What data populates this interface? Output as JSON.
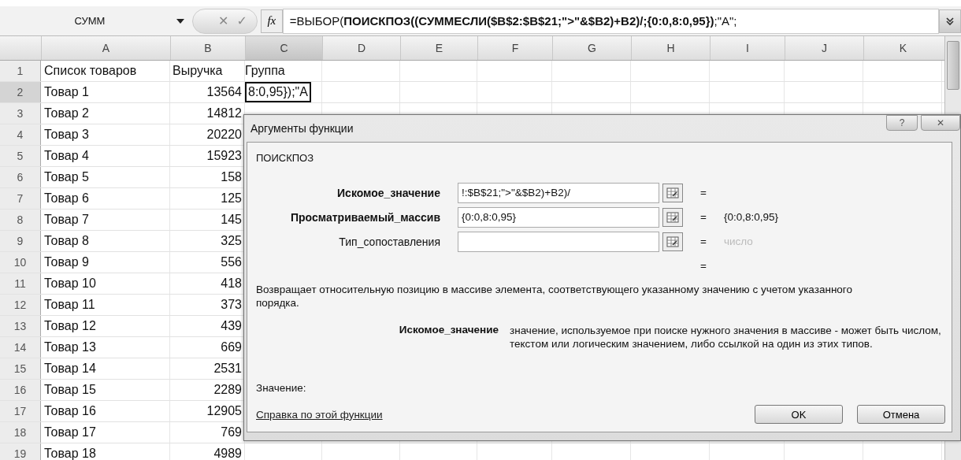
{
  "formula_bar": {
    "name_box": "СУММ",
    "cancel": "✕",
    "enter": "✓",
    "fx": "fx",
    "formula": "=ВЫБОР(**ПОИСКПОЗ((СУММЕСЛИ($B$2:$B$21;\">\"&$B2)+B2)/;{0:0,8:0,95})**;\"A\";"
  },
  "columns": [
    {
      "label": "A",
      "selected": false
    },
    {
      "label": "B",
      "selected": false
    },
    {
      "label": "C",
      "selected": true
    },
    {
      "label": "D",
      "selected": false
    },
    {
      "label": "E",
      "selected": false
    },
    {
      "label": "F",
      "selected": false
    },
    {
      "label": "G",
      "selected": false
    },
    {
      "label": "H",
      "selected": false
    },
    {
      "label": "I",
      "selected": false
    },
    {
      "label": "J",
      "selected": false
    },
    {
      "label": "K",
      "selected": false
    }
  ],
  "rows": [
    {
      "row": "1",
      "kind": "label",
      "selected": false,
      "a": "Список товаров",
      "b": "Выручка",
      "c": "Группа"
    },
    {
      "row": "2",
      "kind": "item",
      "selected": true,
      "a": "Товар 1",
      "b": "13564",
      "c": "8:0,95});\"A",
      "editing": true
    },
    {
      "row": "3",
      "kind": "item",
      "selected": false,
      "a": "Товар 2",
      "b": "14812"
    },
    {
      "row": "4",
      "kind": "item",
      "selected": false,
      "a": "Товар 3",
      "b": "20220"
    },
    {
      "row": "5",
      "kind": "item",
      "selected": false,
      "a": "Товар 4",
      "b": "15923"
    },
    {
      "row": "6",
      "kind": "item",
      "selected": false,
      "a": "Товар 5",
      "b": "158"
    },
    {
      "row": "7",
      "kind": "item",
      "selected": false,
      "a": "Товар 6",
      "b": "125"
    },
    {
      "row": "8",
      "kind": "item",
      "selected": false,
      "a": "Товар 7",
      "b": "145"
    },
    {
      "row": "9",
      "kind": "item",
      "selected": false,
      "a": "Товар 8",
      "b": "325"
    },
    {
      "row": "10",
      "kind": "item",
      "selected": false,
      "a": "Товар 9",
      "b": "556"
    },
    {
      "row": "11",
      "kind": "item",
      "selected": false,
      "a": "Товар 10",
      "b": "418"
    },
    {
      "row": "12",
      "kind": "item",
      "selected": false,
      "a": "Товар 11",
      "b": "373"
    },
    {
      "row": "13",
      "kind": "item",
      "selected": false,
      "a": "Товар 12",
      "b": "439"
    },
    {
      "row": "14",
      "kind": "item",
      "selected": false,
      "a": "Товар 13",
      "b": "669"
    },
    {
      "row": "15",
      "kind": "item",
      "selected": false,
      "a": "Товар 14",
      "b": "2531"
    },
    {
      "row": "16",
      "kind": "item",
      "selected": false,
      "a": "Товар 15",
      "b": "2289"
    },
    {
      "row": "17",
      "kind": "item",
      "selected": false,
      "a": "Товар 16",
      "b": "12905"
    },
    {
      "row": "18",
      "kind": "item",
      "selected": false,
      "a": "Товар 17",
      "b": "769"
    },
    {
      "row": "19",
      "kind": "item",
      "selected": false,
      "a": "Товар 18",
      "b": "4989"
    }
  ],
  "dialog": {
    "title": "Аргументы функции",
    "help": "?",
    "close": "✕",
    "function": "ПОИСКПОЗ",
    "arguments": [
      {
        "label": "Искомое_значение",
        "required": true,
        "value": "!:$B$21;\">\"&$B2)+B2)/"
      },
      {
        "label": "Просматриваемый_массив",
        "required": true,
        "value": "{0:0,8:0,95}",
        "result": "{0:0,8:0,95}"
      },
      {
        "label": "Тип_сопоставления",
        "required": false,
        "result": "число",
        "muted": true
      }
    ],
    "equals": "=",
    "function_result": "=",
    "description": "Возвращает относительную позицию в массиве элемента, соответствующего указанному значению с учетом указанного порядка.",
    "arg_help_name": "Искомое_значение",
    "arg_help_text": "значение, используемое при поиске нужного значения в массиве - может быть числом, текстом или логическим значением, либо ссылкой на один из этих типов.",
    "value_label": "Значение:",
    "help_link": "Справка по этой функции",
    "ok": "OK",
    "cancel": "Отмена"
  }
}
